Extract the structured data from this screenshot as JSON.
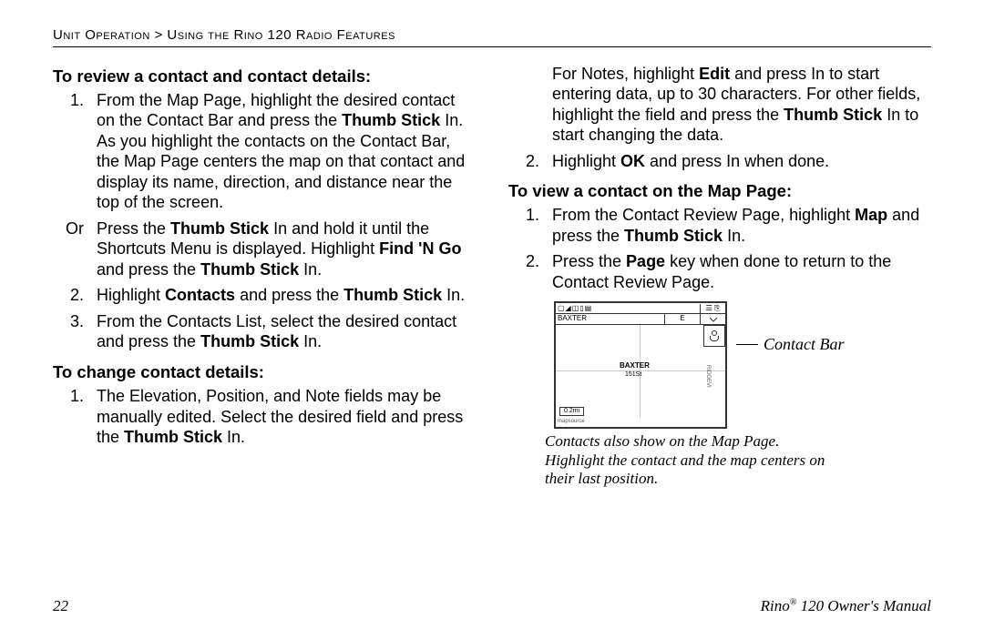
{
  "breadcrumb": "Unit Operation > Using the Rino 120 Radio Features",
  "left": {
    "h1": "To review a contact and contact details:",
    "step1_pre": "From the Map Page, highlight the desired contact on the Contact Bar and press the ",
    "step1_b1": "Thumb Stick",
    "step1_post": " In. As you highlight the contacts on the Contact Bar, the Map Page centers the map on that contact and display its name, direction, and distance near the top of the screen.",
    "or_num": "Or",
    "or_pre": "Press the ",
    "or_b1": "Thumb Stick",
    "or_mid": " In and hold it until the Shortcuts Menu is displayed. Highlight ",
    "or_b2": "Find 'N Go",
    "or_post1": " and press the ",
    "or_b3": "Thumb Stick",
    "or_post2": " In.",
    "step2_pre": "Highlight ",
    "step2_b1": "Contacts",
    "step2_mid": " and press the ",
    "step2_b2": "Thumb Stick",
    "step2_post": " In.",
    "step3_pre": "From the Contacts List, select the desired contact and press the ",
    "step3_b1": "Thumb Stick",
    "step3_post": " In.",
    "h2": "To change contact details:",
    "c1_pre": "The Elevation, Position, and Note fields may be manually edited. Select the desired field and press the ",
    "c1_b1": "Thumb Stick",
    "c1_post": " In."
  },
  "right": {
    "cont1_pre": "For Notes, highlight ",
    "cont1_b1": "Edit",
    "cont1_mid": " and press In to start entering data, up to 30 characters. For other fields, highlight the field and press the ",
    "cont1_b2": "Thumb Stick",
    "cont1_post": " In to start changing the data.",
    "cont2_pre": "Highlight ",
    "cont2_b1": "OK",
    "cont2_post": " and press In when done.",
    "h3": "To view a contact on the Map Page:",
    "v1_pre": "From the Contact Review Page, highlight ",
    "v1_b1": "Map",
    "v1_mid": " and press the ",
    "v1_b2": "Thumb Stick",
    "v1_post": " In.",
    "v2_pre": "Press the ",
    "v2_b1": "Page",
    "v2_post": " key when done to return to the Contact Review Page.",
    "figure": {
      "topbar_icons": "▢◢◫▯▤",
      "topbar_right": "☰ ⎘",
      "row2_left": "BAXTER",
      "row2_mid": "E",
      "center_label": "BAXTER",
      "center_sub": "151St",
      "road": "RIDGEVI",
      "scale": "0.2mi",
      "mapsrc": "mapsource"
    },
    "callout": "Contact Bar",
    "caption": "Contacts also show on the Map Page. Highlight the contact and the map centers on their last position."
  },
  "footer": {
    "page": "22",
    "manual_pre": "Rino",
    "manual_reg": "®",
    "manual_post": " 120 Owner's Manual"
  }
}
